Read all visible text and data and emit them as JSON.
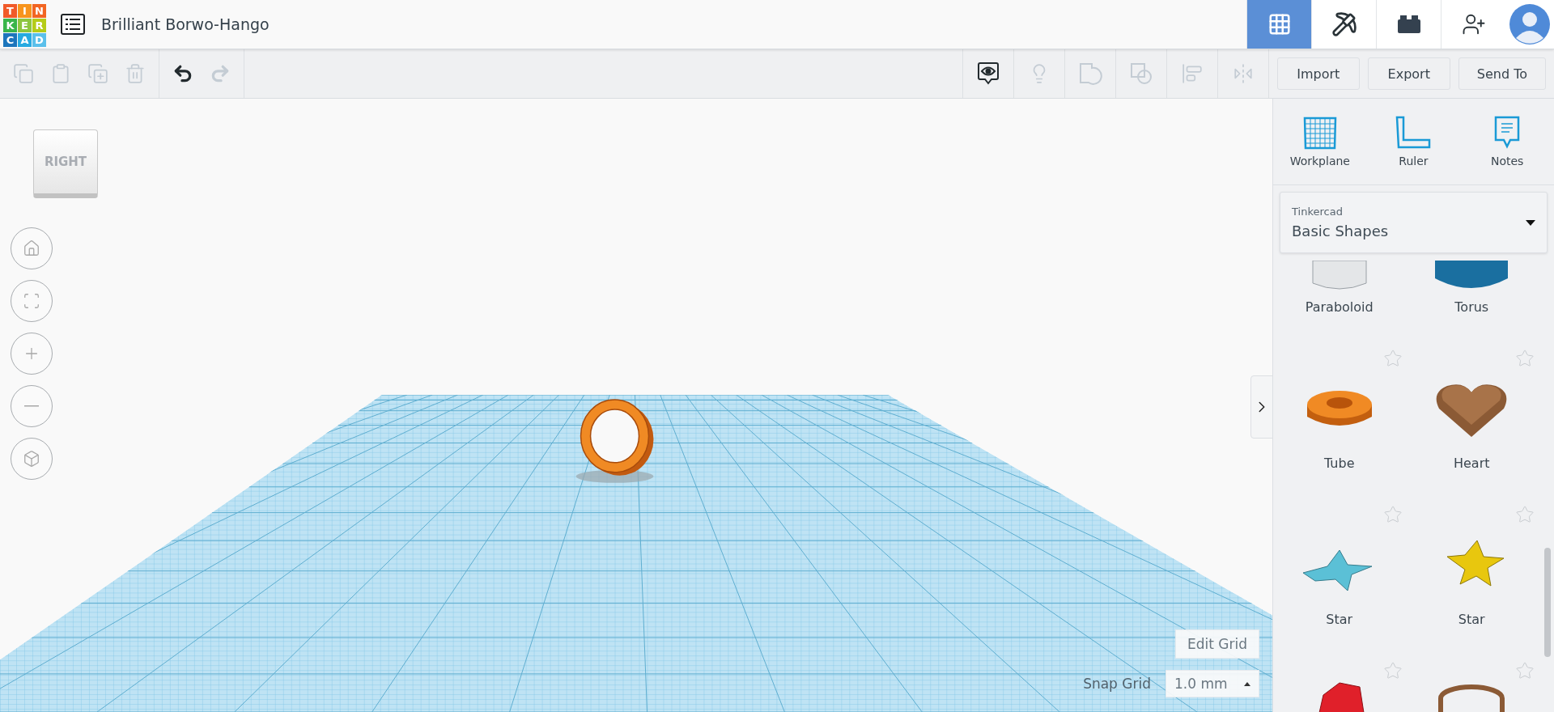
{
  "logo": {
    "letters": [
      {
        "char": "T",
        "color": "#f15a29"
      },
      {
        "char": "I",
        "color": "#f7941d"
      },
      {
        "char": "N",
        "color": "#f26522"
      },
      {
        "char": "K",
        "color": "#39b54a"
      },
      {
        "char": "E",
        "color": "#8dc63f"
      },
      {
        "char": "R",
        "color": "#b5cc18"
      },
      {
        "char": "C",
        "color": "#1c75bc"
      },
      {
        "char": "A",
        "color": "#27aae1"
      },
      {
        "char": "D",
        "color": "#5bc0eb"
      }
    ]
  },
  "title": "Brilliant Borwo-Hango",
  "modes": [
    {
      "kind": "grid",
      "selected": true
    },
    {
      "kind": "pickaxe",
      "selected": false
    },
    {
      "kind": "brick",
      "selected": false
    }
  ],
  "toolbar": {
    "edit": [
      {
        "kind": "copy",
        "disabled": true
      },
      {
        "kind": "paste",
        "disabled": true
      },
      {
        "kind": "duplicate",
        "disabled": true
      },
      {
        "kind": "delete",
        "disabled": true
      }
    ],
    "history": [
      {
        "kind": "undo",
        "disabled": false
      },
      {
        "kind": "redo",
        "disabled": true
      }
    ],
    "view": [
      {
        "kind": "notes-toggle",
        "disabled": false
      },
      {
        "kind": "light",
        "disabled": true
      },
      {
        "kind": "solid",
        "disabled": true
      },
      {
        "kind": "hole",
        "disabled": true
      },
      {
        "kind": "align",
        "disabled": true
      },
      {
        "kind": "mirror",
        "disabled": true
      }
    ],
    "buttons": [
      "Import",
      "Export",
      "Send To"
    ]
  },
  "view_cube": "RIGHT",
  "nav": [
    {
      "kind": "home"
    },
    {
      "kind": "fit"
    },
    {
      "kind": "zoom-in"
    },
    {
      "kind": "zoom-out"
    },
    {
      "kind": "ortho"
    }
  ],
  "panel": {
    "tools": [
      {
        "kind": "workplane",
        "label": "Workplane"
      },
      {
        "kind": "ruler",
        "label": "Ruler"
      },
      {
        "kind": "notes",
        "label": "Notes"
      }
    ],
    "library": {
      "source": "Tinkercad",
      "value": "Basic Shapes"
    },
    "shapes": [
      {
        "kind": "paraboloid",
        "label": "Paraboloid"
      },
      {
        "kind": "torus",
        "label": "Torus"
      },
      {
        "kind": "tube",
        "label": "Tube"
      },
      {
        "kind": "heart",
        "label": "Heart"
      },
      {
        "kind": "star-pyramid",
        "label": "Star"
      },
      {
        "kind": "star",
        "label": "Star"
      },
      {
        "kind": "polyhedron"
      },
      {
        "kind": "ring"
      }
    ]
  },
  "grid": {
    "edit_button": "Edit Grid",
    "snap_label": "Snap Grid",
    "snap_value": "1.0 mm"
  }
}
